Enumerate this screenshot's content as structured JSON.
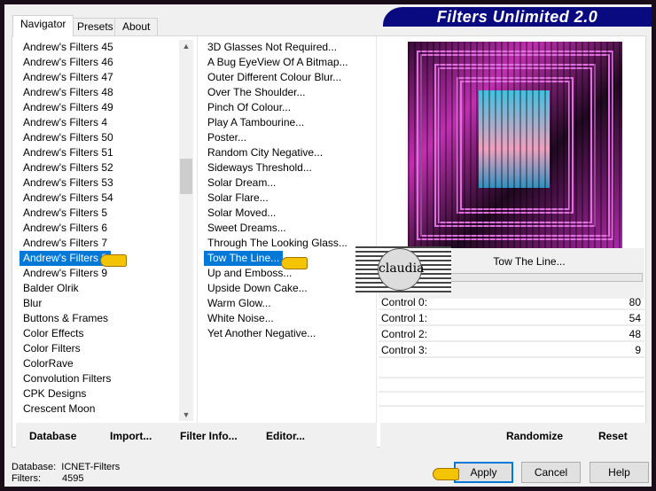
{
  "title": "Filters Unlimited 2.0",
  "tabs": [
    "Navigator",
    "Presets",
    "About"
  ],
  "categories": [
    "Andrew's Filters 45",
    "Andrew's Filters 46",
    "Andrew's Filters 47",
    "Andrew's Filters 48",
    "Andrew's Filters 49",
    "Andrew's Filters 4",
    "Andrew's Filters 50",
    "Andrew's Filters 51",
    "Andrew's Filters 52",
    "Andrew's Filters 53",
    "Andrew's Filters 54",
    "Andrew's Filters 5",
    "Andrew's Filters 6",
    "Andrew's Filters 7",
    "Andrew's Filters 8",
    "Andrew's Filters 9",
    "Balder Olrik",
    "Blur",
    "Buttons & Frames",
    "Color Effects",
    "Color Filters",
    "ColorRave",
    "Convolution Filters",
    "CPK Designs",
    "Crescent Moon"
  ],
  "selected_category": "Andrew's Filters 8",
  "filters": [
    "3D Glasses Not Required...",
    "A Bug EyeView Of A Bitmap...",
    "Outer Different Colour Blur...",
    "Over The Shoulder...",
    "Pinch Of Colour...",
    "Play A Tambourine...",
    "Poster...",
    "Random City Negative...",
    "Sideways Threshold...",
    "Solar Dream...",
    "Solar Flare...",
    "Solar Moved...",
    "Sweet Dreams...",
    "Through The Looking Glass...",
    "Tow The Line...",
    "Up and Emboss...",
    "Upside Down Cake...",
    "Warm Glow...",
    "White Noise...",
    "Yet Another Negative..."
  ],
  "selected_filter": "Tow The Line...",
  "watermark": "claudia",
  "controls": [
    {
      "label": "Control 0:",
      "value": "80"
    },
    {
      "label": "Control 1:",
      "value": "54"
    },
    {
      "label": "Control 2:",
      "value": "48"
    },
    {
      "label": "Control 3:",
      "value": "9"
    }
  ],
  "buttons": {
    "database": "Database",
    "import": "Import...",
    "filter_info": "Filter Info...",
    "editor": "Editor...",
    "randomize": "Randomize",
    "reset": "Reset",
    "apply": "Apply",
    "cancel": "Cancel",
    "help": "Help"
  },
  "status": {
    "database_label": "Database:",
    "database_value": "ICNET-Filters",
    "filters_label": "Filters:",
    "filters_value": "4595"
  }
}
